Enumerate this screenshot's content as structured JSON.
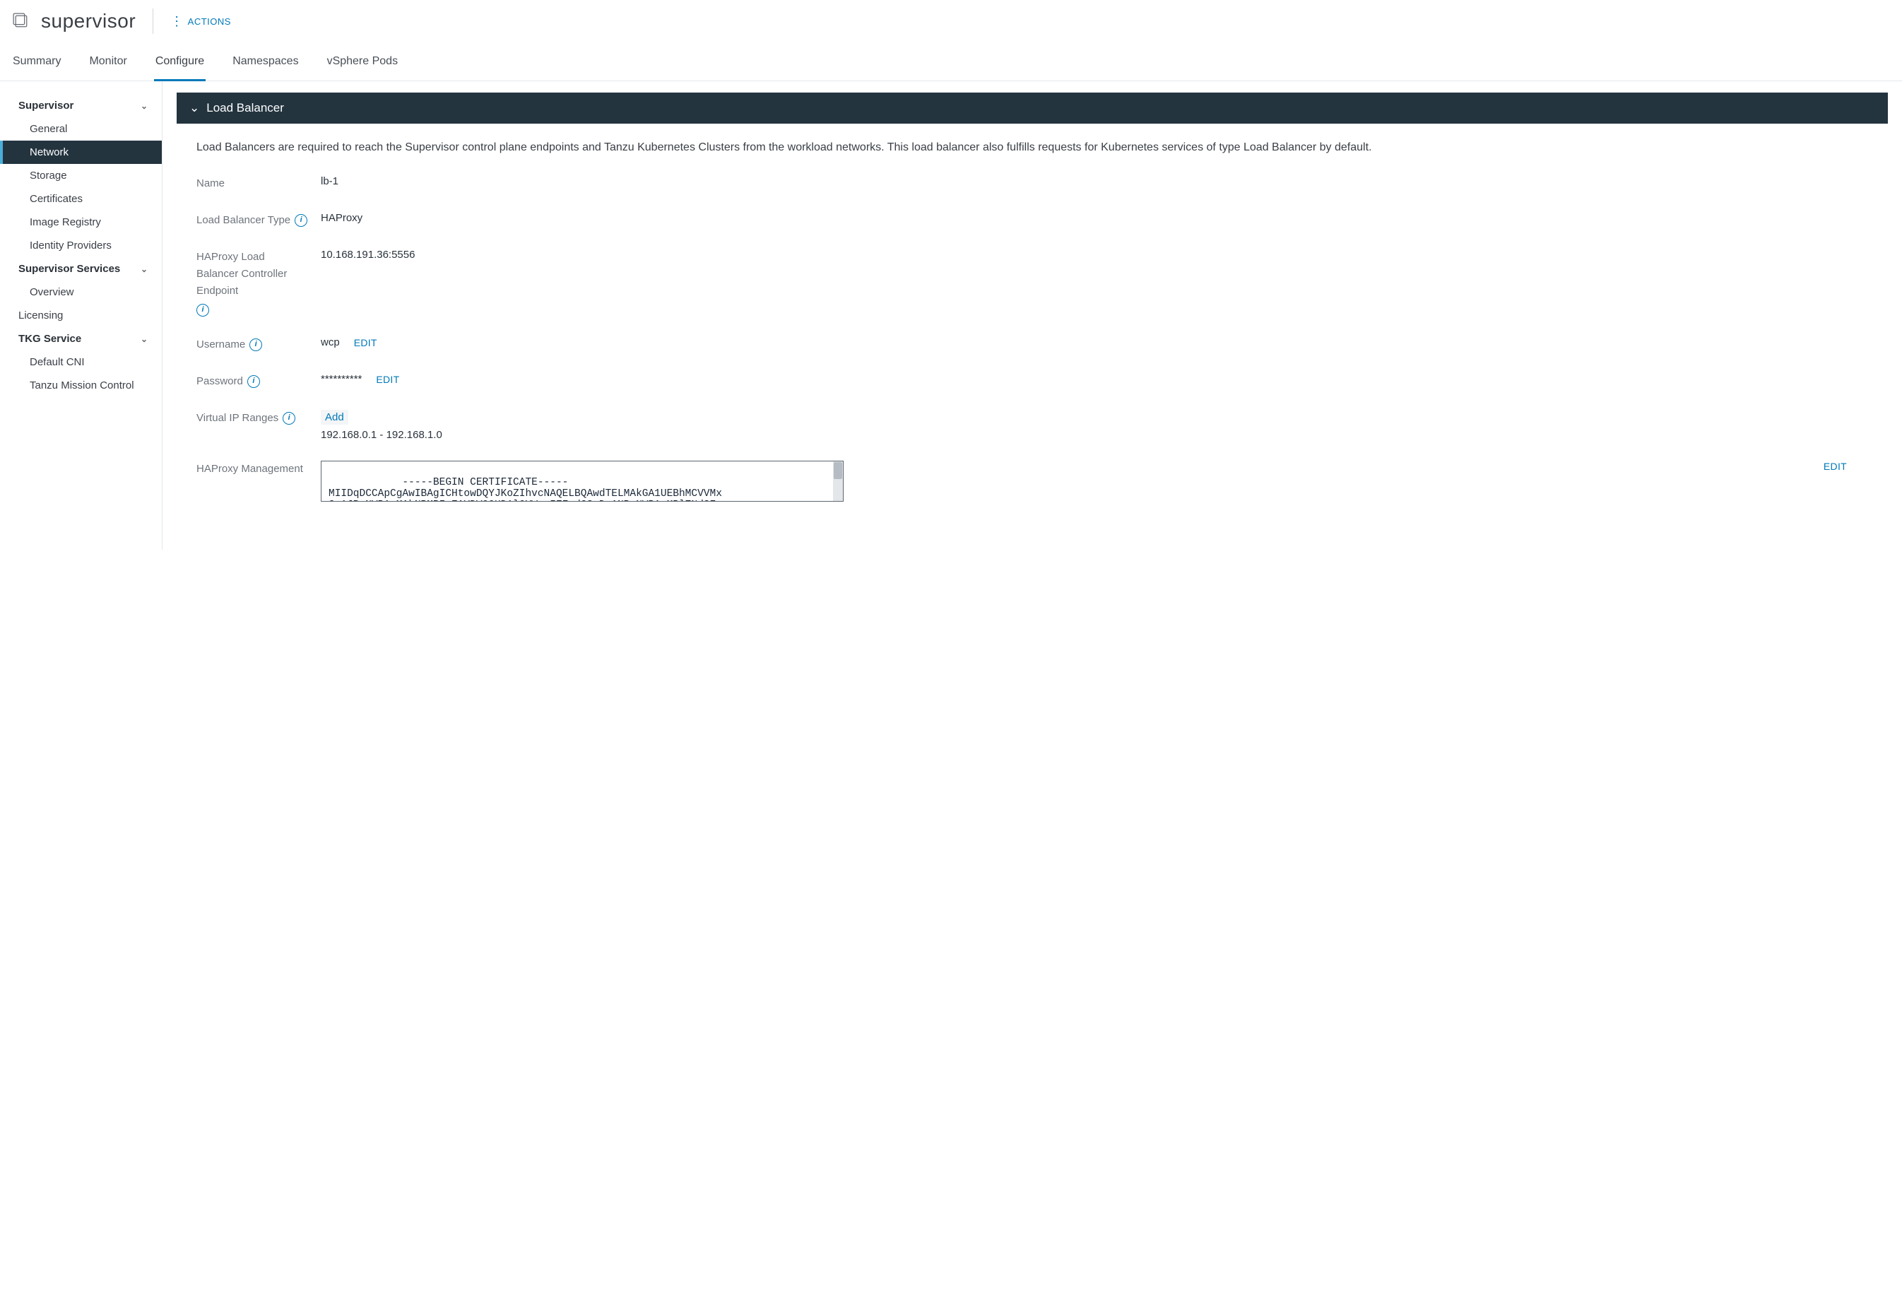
{
  "header": {
    "title": "supervisor",
    "actions_label": "ACTIONS"
  },
  "tabs": [
    {
      "label": "Summary",
      "active": false
    },
    {
      "label": "Monitor",
      "active": false
    },
    {
      "label": "Configure",
      "active": true
    },
    {
      "label": "Namespaces",
      "active": false
    },
    {
      "label": "vSphere Pods",
      "active": false
    }
  ],
  "sidebar": {
    "groups": [
      {
        "header": "Supervisor",
        "items": [
          {
            "label": "General"
          },
          {
            "label": "Network",
            "active": true
          },
          {
            "label": "Storage"
          },
          {
            "label": "Certificates"
          },
          {
            "label": "Image Registry"
          },
          {
            "label": "Identity Providers"
          }
        ]
      },
      {
        "header": "Supervisor Services",
        "items": [
          {
            "label": "Overview"
          }
        ]
      }
    ],
    "flat_items": [
      {
        "label": "Licensing"
      }
    ],
    "groups2": [
      {
        "header": "TKG Service",
        "items": [
          {
            "label": "Default CNI"
          },
          {
            "label": "Tanzu Mission Control"
          }
        ]
      }
    ]
  },
  "panel": {
    "title": "Load Balancer",
    "description": "Load Balancers are required to reach the Supervisor control plane endpoints and Tanzu Kubernetes Clusters from the workload networks. This load balancer also fulfills requests for Kubernetes services of type Load Balancer by default.",
    "fields": {
      "name": {
        "label": "Name",
        "value": "lb-1"
      },
      "type": {
        "label": "Load Balancer Type",
        "value": "HAProxy"
      },
      "endpoint": {
        "label": "HAProxy Load Balancer Controller Endpoint",
        "value": "10.168.191.36:5556"
      },
      "username": {
        "label": "Username",
        "value": "wcp",
        "edit": "EDIT"
      },
      "password": {
        "label": "Password",
        "value": "**********",
        "edit": "EDIT"
      },
      "vip": {
        "label": "Virtual IP Ranges",
        "add": "Add",
        "range": "192.168.0.1 - 192.168.1.0"
      },
      "cert": {
        "label": "HAProxy Management",
        "value": "-----BEGIN CERTIFICATE-----\nMIIDqDCCApCgAwIBAgICHtowDQYJKoZIhvcNAQELBQAwdTELMAkGA1UEBhMCVVMx\nCzAJBgNVBAgMAkNBMRIwEAYDVQQHDAlQYWxvIEFsdG8xDzANBgNVBAoMBlZNd2Fy",
        "edit": "EDIT"
      }
    }
  }
}
